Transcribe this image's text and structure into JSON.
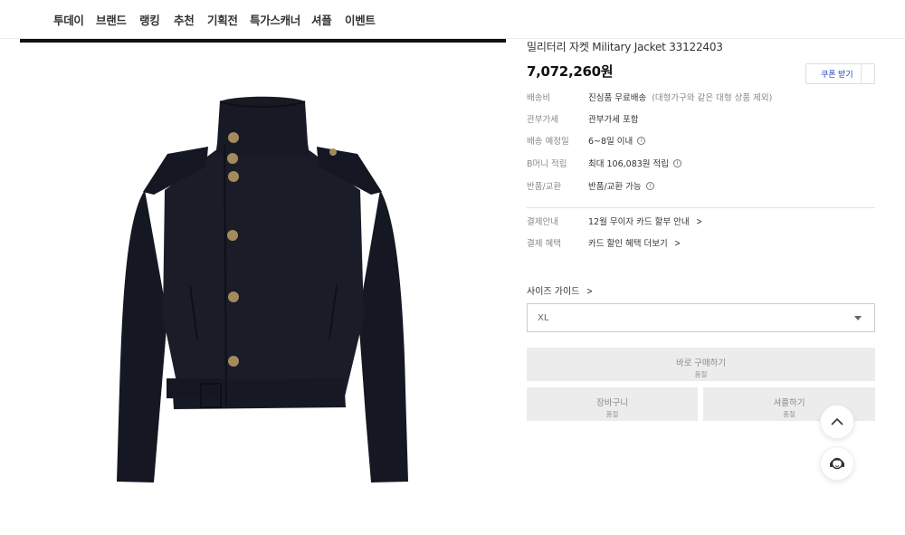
{
  "nav": {
    "items": [
      {
        "label": "투데이"
      },
      {
        "label": "브랜드"
      },
      {
        "label": "랭킹"
      },
      {
        "label": "추천"
      },
      {
        "label": "기획전"
      },
      {
        "label": "특가스캐너"
      },
      {
        "label": "셔플"
      },
      {
        "label": "이벤트"
      }
    ]
  },
  "product": {
    "name": "밀리터리 자켓 Military Jacket 33122403",
    "price": "7,072,260원",
    "coupon_label": "쿠폰 받기",
    "image_icon": "black-military-jacket-image"
  },
  "info": {
    "shipping": {
      "label": "배송비",
      "value": "진심품 무료배송",
      "note": "(대형가구와 같은 대형 상품 제외)"
    },
    "duty": {
      "label": "관부가세",
      "value": "관부가세 포함"
    },
    "eta": {
      "label": "배송 예정일",
      "value": "6~8일 이내"
    },
    "points": {
      "label": "B머니 적립",
      "value": "최대 106,083원 적립"
    },
    "returns": {
      "label": "반품/교환",
      "value": "반품/교환 가능"
    },
    "payment": {
      "label": "결제안내",
      "value": "12월 무이자 카드 할부 안내"
    },
    "benefits": {
      "label": "결제 혜택",
      "value": "카드 할인 혜택 더보기"
    }
  },
  "size": {
    "guide_label": "사이즈 가이드",
    "selected": "XL"
  },
  "buttons": {
    "buy": {
      "label": "바로 구매하기",
      "sub": "품절"
    },
    "cart": {
      "label": "장바구니",
      "sub": "품절"
    },
    "shuffle": {
      "label": "셔플하기",
      "sub": "품절"
    }
  },
  "floating": {
    "top_icon": "chevron-up-icon",
    "support_icon": "customer-support-icon"
  },
  "colors": {
    "jacket": "#181b26",
    "button_gold": "#a48a5c",
    "coupon_text": "#2244bb",
    "disabled_bg": "#ececec"
  }
}
